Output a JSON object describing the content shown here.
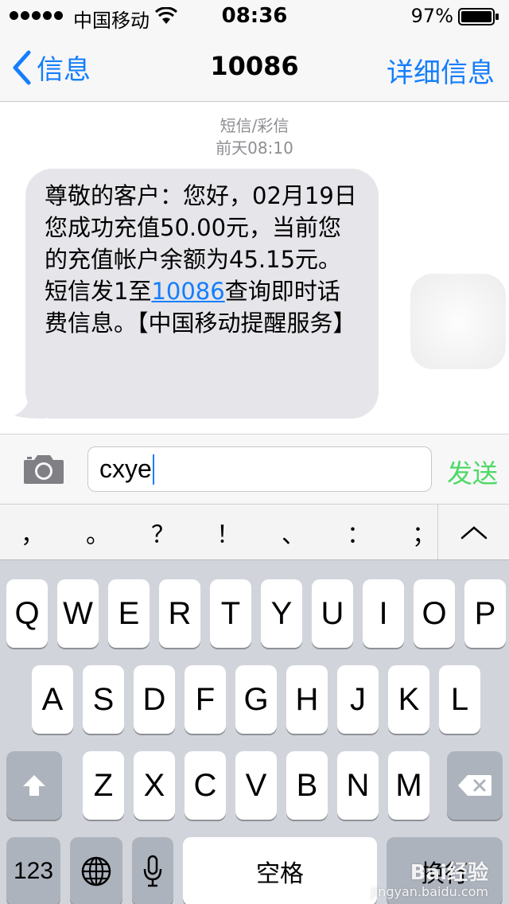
{
  "status": {
    "carrier": "中国移动",
    "time": "08:36",
    "battery": "97%"
  },
  "nav": {
    "back_label": "信息",
    "title": "10086",
    "details_label": "详细信息"
  },
  "conversation": {
    "message_type": "短信/彩信",
    "timestamp": "前天08:10",
    "message": {
      "text_before_link": "尊敬的客户：您好，02月19日您成功充值50.00元，当前您的充值帐户余额为45.15元。短信发1至",
      "link": "10086",
      "text_after_link": "查询即时话费信息。【中国移动提醒服务】"
    }
  },
  "composer": {
    "input_value": "cxye",
    "send_label": "发送"
  },
  "punctuation": [
    "，",
    "。",
    "？",
    "！",
    "、",
    "：",
    "；"
  ],
  "keyboard": {
    "row1": [
      "Q",
      "W",
      "E",
      "R",
      "T",
      "Y",
      "U",
      "I",
      "O",
      "P"
    ],
    "row2": [
      "A",
      "S",
      "D",
      "F",
      "G",
      "H",
      "J",
      "K",
      "L"
    ],
    "row3": [
      "Z",
      "X",
      "C",
      "V",
      "B",
      "N",
      "M"
    ],
    "numbers_label": "123",
    "space_label": "空格",
    "return_label": "换行"
  },
  "watermark": {
    "logo": "Bai",
    "logo2": "经验",
    "url": "jingyan.baidu.com"
  },
  "colors": {
    "accent": "#157efb",
    "send": "#4cd964",
    "bubble": "#e5e5ea",
    "keyboard": "#d1d5db"
  },
  "icons": [
    "wifi-icon",
    "battery-icon",
    "back-chevron-icon",
    "camera-icon",
    "chevron-up-icon",
    "shift-icon",
    "delete-icon",
    "globe-icon",
    "microphone-icon"
  ]
}
